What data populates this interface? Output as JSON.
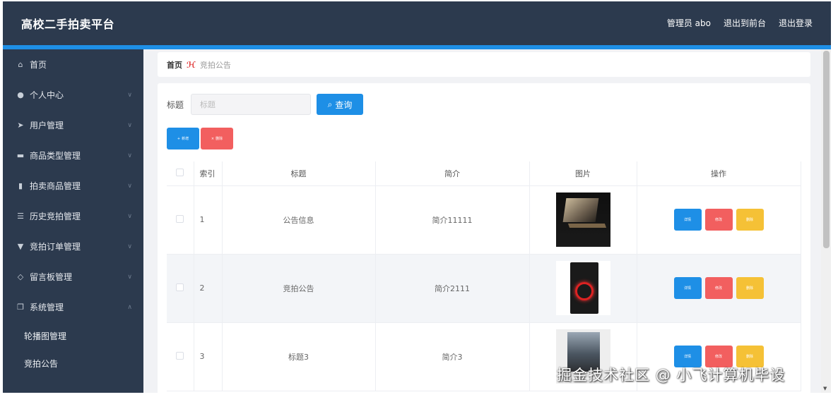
{
  "header": {
    "brand": "高校二手拍卖平台",
    "admin": "管理员 abo",
    "to_front": "退出到前台",
    "logout": "退出登录"
  },
  "sidebar": {
    "items": [
      {
        "label": "首页",
        "icon": "home-icon"
      },
      {
        "label": "个人中心",
        "icon": "user-icon"
      },
      {
        "label": "用户管理",
        "icon": "send-icon"
      },
      {
        "label": "商品类型管理",
        "icon": "monitor-icon"
      },
      {
        "label": "拍卖商品管理",
        "icon": "bar-chart-icon"
      },
      {
        "label": "历史竞拍管理",
        "icon": "list-icon"
      },
      {
        "label": "竞拍订单管理",
        "icon": "flag-icon"
      },
      {
        "label": "留言板管理",
        "icon": "bell-icon"
      },
      {
        "label": "系统管理",
        "icon": "copy-icon"
      }
    ],
    "sub_items": [
      "轮播图管理",
      "竞拍公告"
    ]
  },
  "breadcrumb": {
    "home": "首页",
    "current": "竞拍公告"
  },
  "search": {
    "label": "标题",
    "placeholder": "标题",
    "button": "查询"
  },
  "actions": {
    "add": "新增",
    "delete": "删除"
  },
  "table": {
    "headers": [
      "索引",
      "标题",
      "简介",
      "图片",
      "操作"
    ],
    "rows": [
      {
        "index": "1",
        "title": "公告信息",
        "desc": "简介11111",
        "image": "laptop"
      },
      {
        "index": "2",
        "title": "竞拍公告",
        "desc": "简介2111",
        "image": "gaming-pc"
      },
      {
        "index": "3",
        "title": "标题3",
        "desc": "简介3",
        "image": "poster"
      }
    ],
    "ops": {
      "detail": "详情",
      "edit": "修改",
      "delete": "删除"
    }
  },
  "watermark": "掘金技术社区 @ 小飞计算机毕设",
  "colors": {
    "header": "#2c3a4e",
    "accent": "#1e8fe6",
    "danger": "#f25f5f",
    "warning": "#f5c136"
  }
}
